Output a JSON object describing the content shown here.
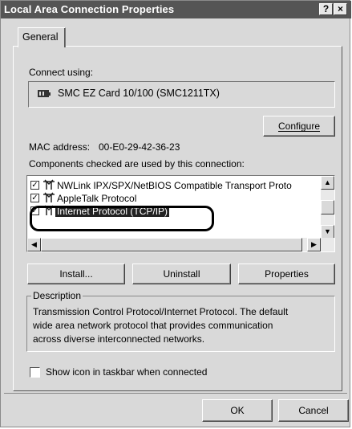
{
  "window": {
    "title": "Local Area Connection Properties",
    "help_label": "?",
    "close_label": "×"
  },
  "tab": {
    "label": "General"
  },
  "connect_using": {
    "label": "Connect using:",
    "adapter": "SMC EZ Card 10/100 (SMC1211TX)"
  },
  "configure_button": "Configure",
  "mac": {
    "label": "MAC address:",
    "value": "00-E0-29-42-36-23"
  },
  "components": {
    "label": "Components checked are used by this connection:",
    "items": [
      {
        "label": "NWLink IPX/SPX/NetBIOS Compatible Transport Proto",
        "checked": true
      },
      {
        "label": "AppleTalk Protocol",
        "checked": true
      },
      {
        "label": "Internet Protocol (TCP/IP)",
        "checked": true,
        "selected": true
      }
    ]
  },
  "buttons": {
    "install": "Install...",
    "uninstall": "Uninstall",
    "properties": "Properties",
    "ok": "OK",
    "cancel": "Cancel"
  },
  "description": {
    "title": "Description",
    "lines": [
      "Transmission Control Protocol/Internet Protocol. The default",
      "wide area network protocol that provides communication",
      "across diverse interconnected networks."
    ]
  },
  "show_icon": {
    "label": "Show icon in taskbar when connected",
    "checked": false
  },
  "colors": {
    "titlebar": "#555555",
    "face": "#d9d9d9",
    "highlight_ring": "#000000"
  }
}
